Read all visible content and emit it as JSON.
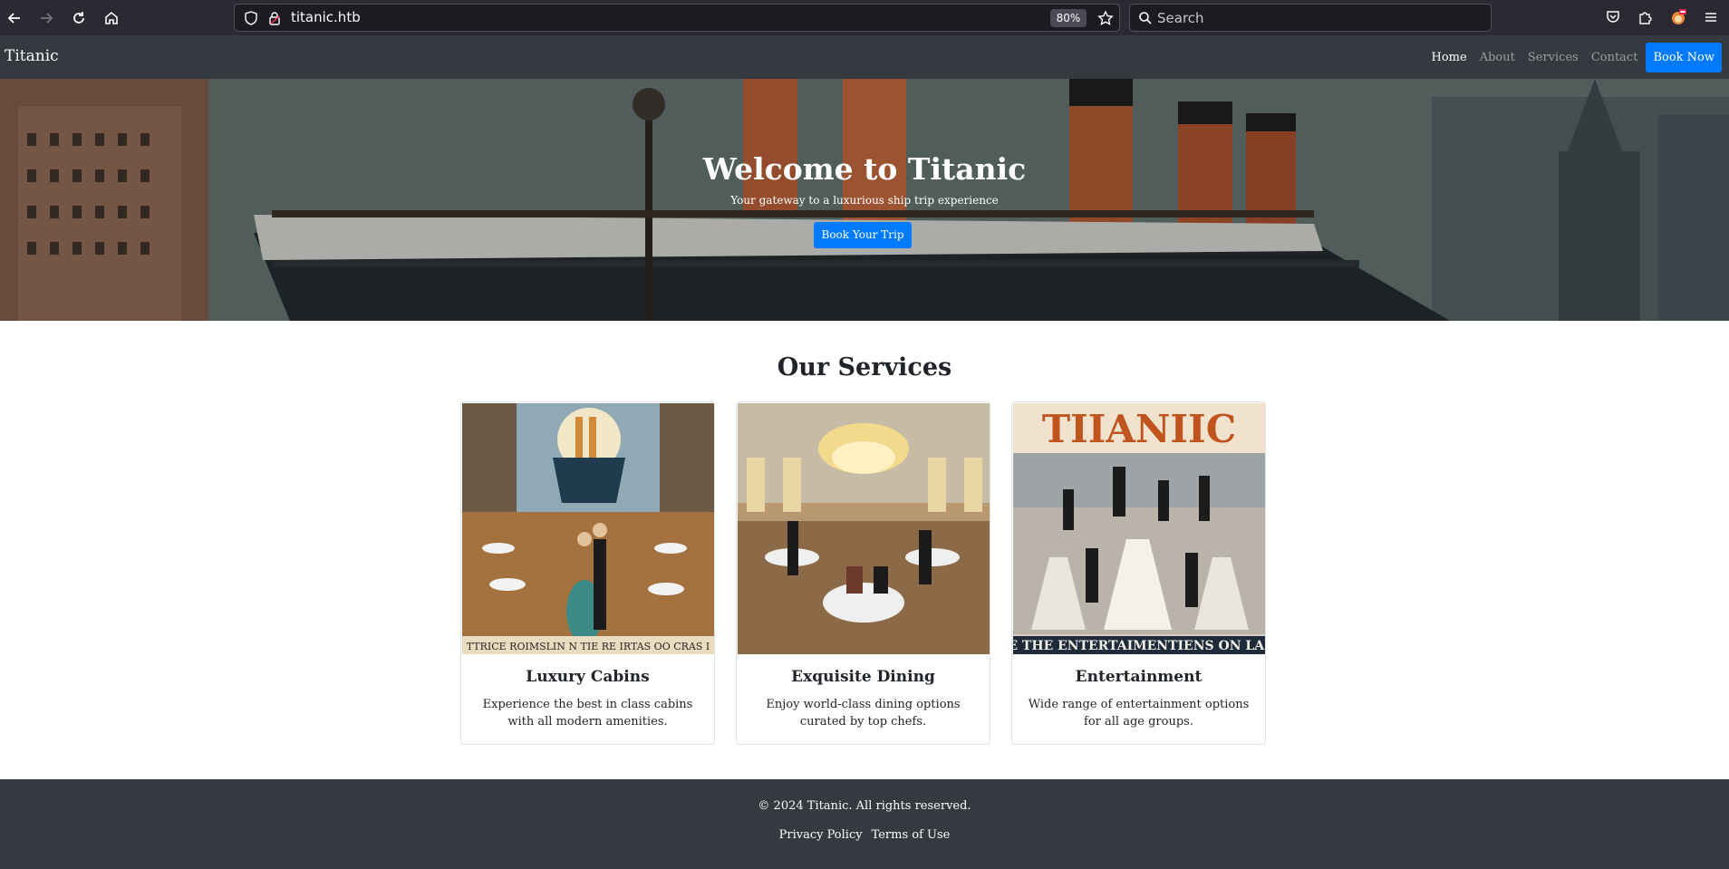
{
  "browser": {
    "url": "titanic.htb",
    "zoom": "80%",
    "search_placeholder": "Search"
  },
  "site": {
    "brand": "Titanic",
    "nav": [
      {
        "label": "Home",
        "active": true
      },
      {
        "label": "About",
        "active": false
      },
      {
        "label": "Services",
        "active": false
      },
      {
        "label": "Contact",
        "active": false
      }
    ],
    "book_now": "Book Now"
  },
  "hero": {
    "title": "Welcome to Titanic",
    "subtitle": "Your gateway to a luxurious ship trip experience",
    "button": "Book Your Trip"
  },
  "services": {
    "title": "Our Services",
    "cards": [
      {
        "title": "Luxury Cabins",
        "text": "Experience the best in class cabins with all modern amenities.",
        "poster_caption": "TTRICE ROIMSLIN N TIE RE IRTAS OO CRAS I"
      },
      {
        "title": "Exquisite Dining",
        "text": "Enjoy world-class dining options curated by top chefs."
      },
      {
        "title": "Entertainment",
        "text": "Wide range of entertainment options for all age groups.",
        "poster_heading": "TIIANIIC",
        "poster_caption": "E THE ENTERTAIMENTIENS ON LAI"
      }
    ]
  },
  "footer": {
    "copyright": "© 2024 Titanic. All rights reserved.",
    "links": [
      "Privacy Policy",
      "Terms of Use"
    ]
  },
  "colors": {
    "primary": "#007bff",
    "dark": "#343a40",
    "chrome": "#2b2a33"
  }
}
